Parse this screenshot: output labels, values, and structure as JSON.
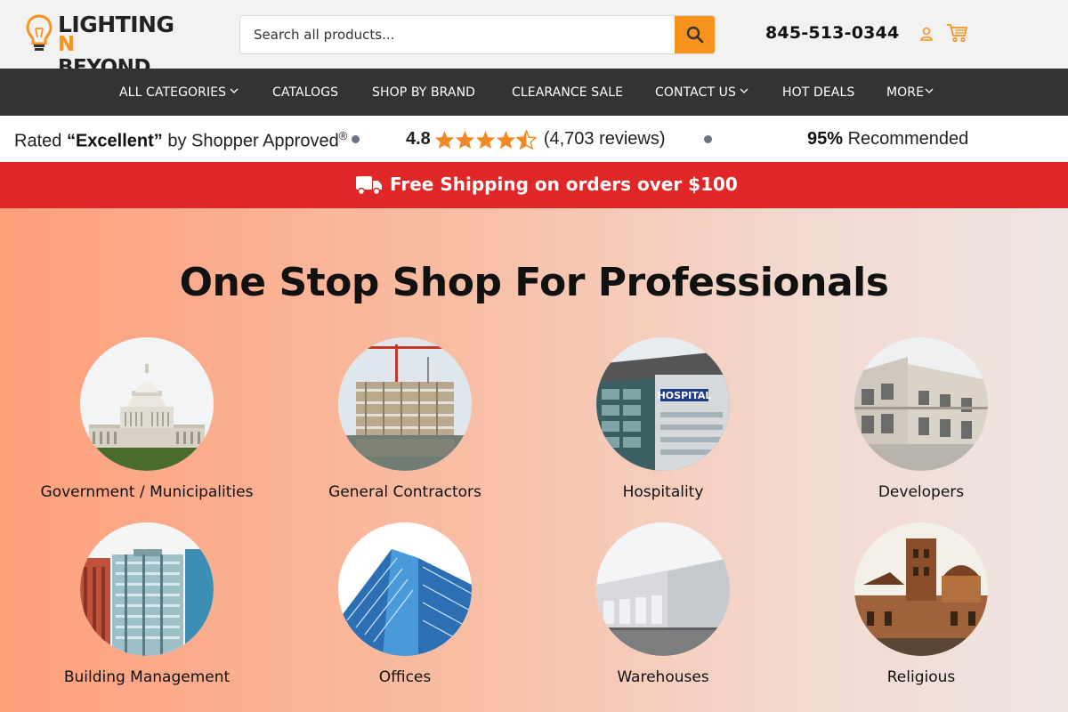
{
  "logo": {
    "line1": "LIGHTING",
    "line2_prefix": "N",
    "line2_rest": " BEYOND"
  },
  "search": {
    "placeholder": "Search all products..."
  },
  "header": {
    "phone": "845-513-0344"
  },
  "nav": {
    "items": [
      {
        "label": "ALL CATEGORIES",
        "has_dropdown": true
      },
      {
        "label": "CATALOGS",
        "has_dropdown": false
      },
      {
        "label": "SHOP BY BRAND",
        "has_dropdown": false
      },
      {
        "label": "CLEARANCE SALE",
        "has_dropdown": false
      },
      {
        "label": "CONTACT US",
        "has_dropdown": true
      },
      {
        "label": "HOT DEALS",
        "has_dropdown": false
      },
      {
        "label": "MORE",
        "has_dropdown": true
      }
    ]
  },
  "rating": {
    "prefix": "Rated ",
    "quality": "“Excellent”",
    "suffix": " by Shopper Approved",
    "reg": "®",
    "score": "4.8",
    "reviews": "(4,703 reviews)",
    "stars_value": 4.8,
    "recommended_pct": "95%",
    "recommended_text": " Recommended"
  },
  "shipping": {
    "message": "Free Shipping on orders over $100"
  },
  "hero": {
    "title": "One Stop Shop For Professionals",
    "categories": [
      {
        "label": "Government / Municipalities",
        "image": "capitol-building"
      },
      {
        "label": "General Contractors",
        "image": "construction-site"
      },
      {
        "label": "Hospitality",
        "image": "hospital-building"
      },
      {
        "label": "Developers",
        "image": "townhouses"
      },
      {
        "label": "Building Management",
        "image": "apartment-tower"
      },
      {
        "label": "Offices",
        "image": "glass-office"
      },
      {
        "label": "Warehouses",
        "image": "warehouse"
      },
      {
        "label": "Religious",
        "image": "church"
      }
    ]
  },
  "colors": {
    "accent": "#f7931e",
    "nav_bg": "#333333",
    "banner_red": "#de2726",
    "star": "#f08a24"
  }
}
